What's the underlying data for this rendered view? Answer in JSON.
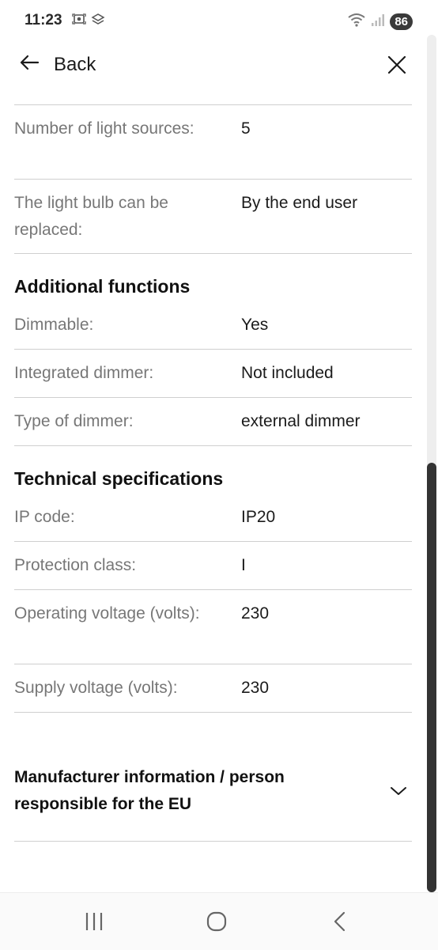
{
  "status_bar": {
    "time": "11:23",
    "battery": "86",
    "icons_left": [
      "screenshot-icon",
      "cast-icon"
    ],
    "icons_right": [
      "wifi-icon",
      "signal-icon"
    ]
  },
  "header": {
    "back_label": "Back",
    "back_icon": "arrow-left-icon",
    "close_icon": "close-icon"
  },
  "rows_top": [
    {
      "label": "Number of light sources:",
      "value": "5"
    },
    {
      "label": "The light bulb can be replaced:",
      "value": "By the end user"
    }
  ],
  "sections": [
    {
      "title": "Additional functions",
      "rows": [
        {
          "label": "Dimmable:",
          "value": "Yes"
        },
        {
          "label": "Integrated dimmer:",
          "value": "Not included"
        },
        {
          "label": "Type of dimmer:",
          "value": "external dimmer"
        }
      ]
    },
    {
      "title": "Technical specifications",
      "rows": [
        {
          "label": "IP code:",
          "value": "IP20"
        },
        {
          "label": "Protection class:",
          "value": "I"
        },
        {
          "label": "Operating voltage (volts):",
          "value": "230"
        },
        {
          "label": "Supply voltage (volts):",
          "value": "230"
        }
      ]
    }
  ],
  "accordion": {
    "title": "Manufacturer information / person responsible for the EU",
    "icon": "chevron-down-icon"
  },
  "nav_bar": {
    "icons": [
      "recent-apps-icon",
      "home-icon",
      "back-nav-icon"
    ]
  },
  "colors": {
    "label": "#777777",
    "value": "#1b1b1b",
    "divider": "#cfcfcf",
    "scroll_thumb": "#333333"
  }
}
